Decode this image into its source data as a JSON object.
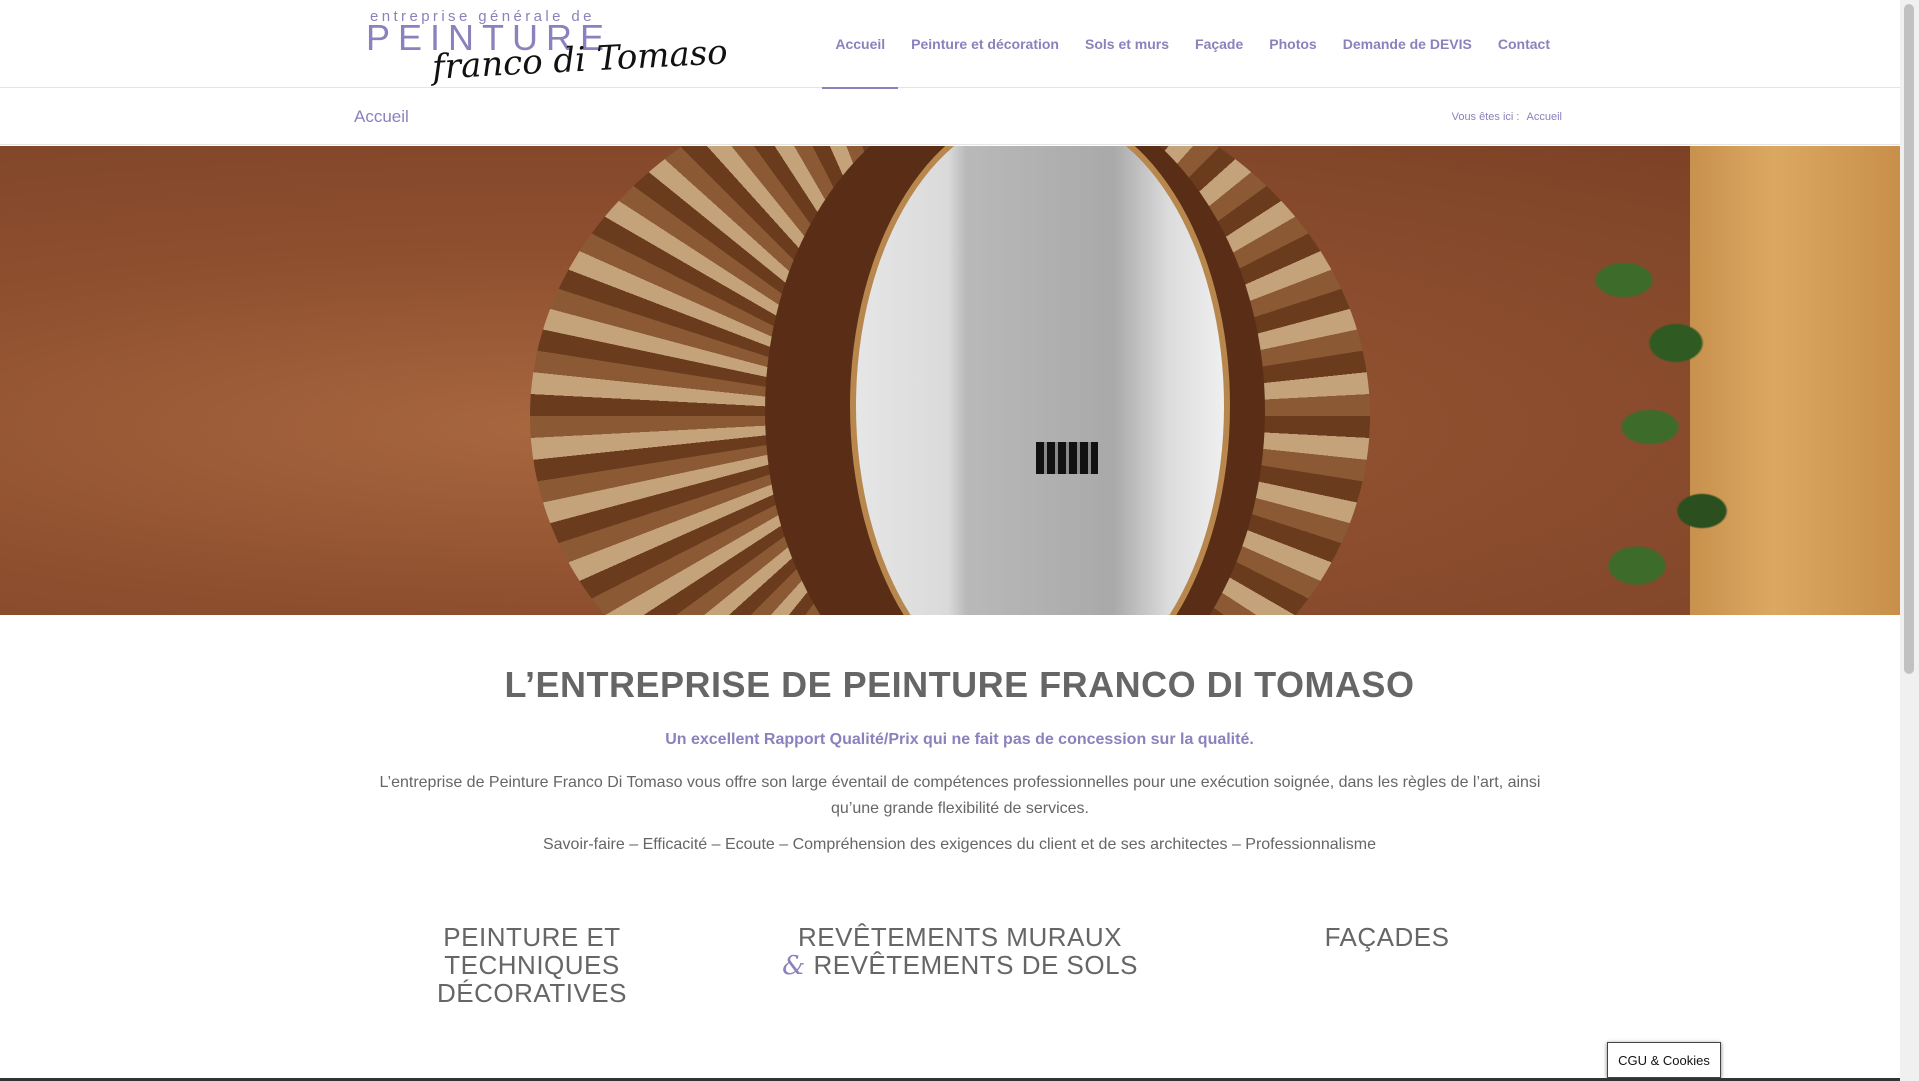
{
  "logo": {
    "line1": "entreprise générale de",
    "line2": "PEINTURE",
    "line3": "franco di Tomaso"
  },
  "nav": {
    "items": [
      {
        "label": "Accueil",
        "active": true
      },
      {
        "label": "Peinture et décoration",
        "active": false
      },
      {
        "label": "Sols et murs",
        "active": false
      },
      {
        "label": "Façade",
        "active": false
      },
      {
        "label": "Photos",
        "active": false
      },
      {
        "label": "Demande de DEVIS",
        "active": false
      },
      {
        "label": "Contact",
        "active": false
      }
    ]
  },
  "titlebar": {
    "page_title": "Accueil",
    "breadcrumb_prefix": "Vous êtes ici :",
    "breadcrumb_current": "Accueil"
  },
  "main": {
    "title": "L’ENTREPRISE DE PEINTURE FRANCO DI TOMASO",
    "tagline": "Un excellent Rapport Qualité/Prix qui ne fait pas de concession sur la qualité.",
    "intro": "L’entreprise de Peinture Franco Di Tomaso vous offre son large éventail de compétences professionnelles pour une exécution soignée, dans les règles de l’art, ainsi qu’une grande flexibilité de services.",
    "values": "Savoir-faire – Efficacité – Ecoute – Compréhension des exigences du client et de ses architectes – Professionnalisme"
  },
  "columns": {
    "col1": "PEINTURE ET TECHNIQUES DÉCORATIVES",
    "col2_line1": "REVÊTEMENTS MURAUX",
    "col2_amp": "&",
    "col2_line2": "REVÊTEMENTS DE SOLS",
    "col3": "FAÇADES"
  },
  "cookie_button": "CGU & Cookies",
  "colors": {
    "accent": "#8a82bd",
    "text": "#666666"
  }
}
